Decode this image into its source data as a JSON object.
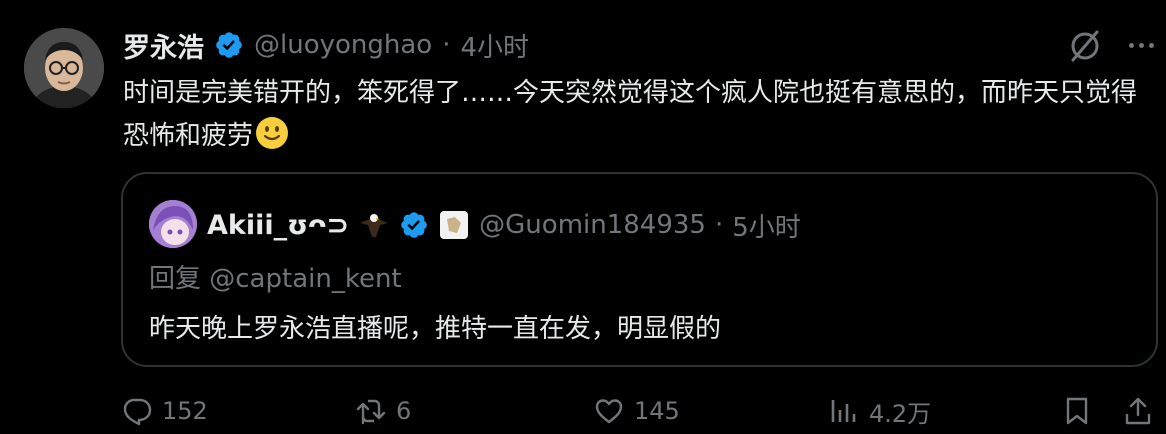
{
  "tweet": {
    "display_name": "罗永浩",
    "handle": "@luoyonghao",
    "separator": "·",
    "time": "4小时",
    "text": "时间是完美错开的，笨死得了……今天突然觉得这个疯人院也挺有意思的，而昨天只觉得恐怖和疲劳",
    "emoji_icon": "slightly-smiling-face-icon"
  },
  "quote": {
    "display_name": "Akiii_ʊᴖ⊃",
    "handle": "@Guomin184935",
    "separator": "·",
    "time": "5小时",
    "reply_to": "回复 @captain_kent",
    "text": "昨天晚上罗永浩直播呢，推特一直在发，明显假的"
  },
  "actions": {
    "replies": "152",
    "reposts": "6",
    "likes": "145",
    "views": "4.2万"
  },
  "colors": {
    "background": "#000000",
    "text": "#e7e9ea",
    "secondary": "#71767b",
    "verified": "#1d9bf0",
    "border": "#2f3336"
  }
}
